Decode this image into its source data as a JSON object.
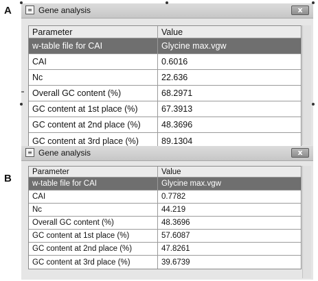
{
  "panels": [
    {
      "letter": "A",
      "window_title": "Gene analysis",
      "close_label": "x",
      "columns": [
        "Parameter",
        "Value"
      ],
      "rows": [
        {
          "parameter": "w-table file for CAI",
          "value": "Glycine max.vgw",
          "selected": true
        },
        {
          "parameter": "CAI",
          "value": "0.6016"
        },
        {
          "parameter": "Nc",
          "value": "22.636"
        },
        {
          "parameter": "Overall GC content (%)",
          "value": "68.2971"
        },
        {
          "parameter": "GC content at 1st place (%)",
          "value": "67.3913"
        },
        {
          "parameter": "GC content at 2nd place (%)",
          "value": "48.3696"
        },
        {
          "parameter": "GC content at 3rd place (%)",
          "value": "89.1304"
        }
      ]
    },
    {
      "letter": "B",
      "window_title": "Gene analysis",
      "close_label": "x",
      "columns": [
        "Parameter",
        "Value"
      ],
      "rows": [
        {
          "parameter": "w-table file for CAI",
          "value": "Glycine max.vgw",
          "selected": true
        },
        {
          "parameter": "CAI",
          "value": "0.7782"
        },
        {
          "parameter": "Nc",
          "value": "44.219"
        },
        {
          "parameter": "Overall GC content (%)",
          "value": "48.3696"
        },
        {
          "parameter": "GC content at 1st place (%)",
          "value": "57.6087"
        },
        {
          "parameter": "GC content at 2nd place (%)",
          "value": "47.8261"
        },
        {
          "parameter": "GC content at 3rd place (%)",
          "value": "39.6739"
        }
      ]
    }
  ],
  "icons": {
    "app": "window-app-icon",
    "close": "close-icon"
  }
}
